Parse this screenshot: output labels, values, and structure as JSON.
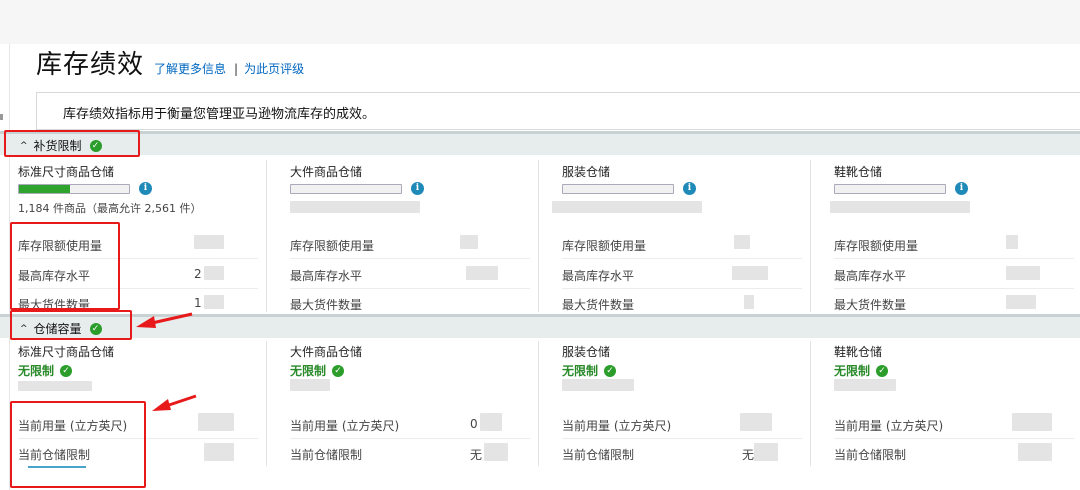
{
  "header": {
    "title": "库存绩效",
    "learn_more": "了解更多信息",
    "separator": "|",
    "rate_page": "为此页评级"
  },
  "description": "库存绩效指标用于衡量您管理亚马逊物流库存的成效。",
  "replenishment": {
    "label": "补货限制",
    "columns": [
      {
        "title": "标准尺寸商品仓储",
        "fill_percent": 46,
        "count_text": "1,184 件商品（最高允许 2,561 件）"
      },
      {
        "title": "大件商品仓储",
        "fill_percent": 0
      },
      {
        "title": "服装仓储",
        "fill_percent": 0
      },
      {
        "title": "鞋靴仓储",
        "fill_percent": 0
      }
    ],
    "rows": [
      "库存限额使用量",
      "最高库存水平",
      "最大货件数量"
    ],
    "std_values": [
      "",
      "2",
      "1"
    ]
  },
  "storage": {
    "label": "仓储容量",
    "columns": [
      {
        "title": "标准尺寸商品仓储",
        "status": "无限制"
      },
      {
        "title": "大件商品仓储",
        "status": "无限制"
      },
      {
        "title": "服装仓储",
        "status": "无限制"
      },
      {
        "title": "鞋靴仓储",
        "status": "无限制"
      }
    ],
    "rows": [
      "当前用量 (立方英尺)",
      "当前仓储限制"
    ],
    "col2_values": [
      "0",
      "无"
    ],
    "col3_values": [
      "",
      "无"
    ]
  },
  "colors": {
    "accent_link": "#0066c0",
    "success": "#2a9d2a",
    "annotation": "#e8191b",
    "section_bg": "#e7ecec"
  },
  "icons": [
    "check-circle-icon",
    "info-icon",
    "chevron-up-icon",
    "arrow-annotation-icon"
  ]
}
